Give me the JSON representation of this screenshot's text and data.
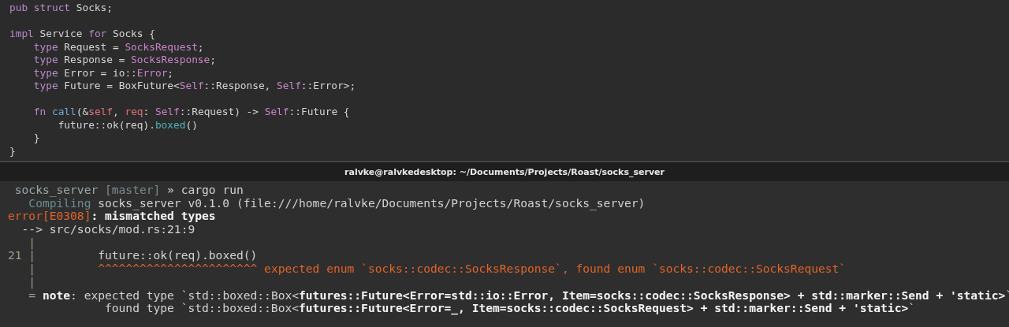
{
  "editor": {
    "lines": [
      {
        "kind": "code",
        "segments": [
          {
            "kind": "keyword",
            "text": "pub struct"
          },
          {
            "kind": "plain",
            "text": " Socks;"
          }
        ]
      },
      {
        "kind": "blank"
      },
      {
        "kind": "code",
        "segments": [
          {
            "kind": "keyword",
            "text": "impl"
          },
          {
            "kind": "plain",
            "text": " Service "
          },
          {
            "kind": "keyword",
            "text": "for"
          },
          {
            "kind": "plain",
            "text": " Socks {"
          }
        ],
        "children": [
          {
            "kind": "code",
            "segments": [
              {
                "kind": "keyword",
                "text": "type"
              },
              {
                "kind": "plain",
                "text": " Request = "
              },
              {
                "kind": "type",
                "text": "SocksRequest"
              },
              {
                "kind": "plain",
                "text": ";"
              }
            ]
          },
          {
            "kind": "code",
            "segments": [
              {
                "kind": "keyword",
                "text": "type"
              },
              {
                "kind": "plain",
                "text": " Response = "
              },
              {
                "kind": "type",
                "text": "SocksResponse"
              },
              {
                "kind": "plain",
                "text": ";"
              }
            ]
          },
          {
            "kind": "code",
            "segments": [
              {
                "kind": "keyword",
                "text": "type"
              },
              {
                "kind": "plain",
                "text": " Error = io::"
              },
              {
                "kind": "type",
                "text": "Error"
              },
              {
                "kind": "plain",
                "text": ";"
              }
            ]
          },
          {
            "kind": "code",
            "segments": [
              {
                "kind": "keyword",
                "text": "type"
              },
              {
                "kind": "plain",
                "text": " Future = BoxFuture<"
              },
              {
                "kind": "type",
                "text": "Self"
              },
              {
                "kind": "plain",
                "text": "::Response, "
              },
              {
                "kind": "type",
                "text": "Self"
              },
              {
                "kind": "plain",
                "text": "::Error>;"
              }
            ]
          },
          {
            "kind": "blank"
          },
          {
            "kind": "code",
            "segments": [
              {
                "kind": "keyword",
                "text": "fn "
              },
              {
                "kind": "function",
                "text": "call"
              },
              {
                "kind": "plain",
                "text": "(&"
              },
              {
                "kind": "variable",
                "text": "self"
              },
              {
                "kind": "plain",
                "text": ", "
              },
              {
                "kind": "variable",
                "text": "req"
              },
              {
                "kind": "plain",
                "text": ": "
              },
              {
                "kind": "type",
                "text": "Self"
              },
              {
                "kind": "plain",
                "text": "::Request) -> "
              },
              {
                "kind": "type",
                "text": "Self"
              },
              {
                "kind": "plain",
                "text": "::Future {"
              }
            ],
            "children": [
              {
                "kind": "code",
                "segments": [
                  {
                    "kind": "plain",
                    "text": "future::ok(req)."
                  },
                  {
                    "kind": "method",
                    "text": "boxed"
                  },
                  {
                    "kind": "plain",
                    "text": "()"
                  }
                ]
              }
            ]
          },
          {
            "kind": "code",
            "segments": [
              {
                "kind": "plain",
                "text": "}"
              }
            ]
          }
        ]
      },
      {
        "kind": "code",
        "segments": [
          {
            "kind": "plain",
            "text": "}"
          }
        ]
      }
    ]
  },
  "terminal": {
    "title": "ralvke@ralvkedesktop: ~/Documents/Projects/Roast/socks_server",
    "lines": [
      {
        "segments": [
          {
            "kind": "prompt",
            "text": " socks_server "
          },
          {
            "kind": "branch",
            "text": "[master]"
          },
          {
            "kind": "plain",
            "text": " » cargo run"
          }
        ]
      },
      {
        "segments": [
          {
            "kind": "dim",
            "text": "   Compiling"
          },
          {
            "kind": "plain",
            "text": " socks_server v0.1.0 (file:///home/ralvke/Documents/Projects/Roast/socks_server)"
          }
        ]
      },
      {
        "segments": [
          {
            "kind": "error",
            "text": "error[E0308]"
          },
          {
            "kind": "bold",
            "text": ": mismatched types"
          }
        ]
      },
      {
        "segments": [
          {
            "kind": "plain",
            "text": "  --> src/socks/mod.rs:21:9"
          }
        ]
      },
      {
        "segments": [
          {
            "kind": "gutter",
            "text": "   |"
          }
        ]
      },
      {
        "segments": [
          {
            "kind": "gutter",
            "text": "21 |"
          },
          {
            "kind": "plain",
            "text": "         future::ok(req).boxed()"
          }
        ]
      },
      {
        "segments": [
          {
            "kind": "gutter",
            "text": "   |"
          },
          {
            "kind": "error",
            "text": "         ^^^^^^^^^^^^^^^^^^^^^^^ expected enum `socks::codec::SocksResponse`, found enum `socks::codec::SocksRequest`"
          }
        ]
      },
      {
        "segments": [
          {
            "kind": "gutter",
            "text": "   |"
          }
        ]
      },
      {
        "segments": [
          {
            "kind": "gutter",
            "text": "   = "
          },
          {
            "kind": "bold",
            "text": "note"
          },
          {
            "kind": "plain",
            "text": ": expected type `std::boxed::Box<"
          },
          {
            "kind": "bold",
            "text": "futures::Future<Error=std::io::Error, Item=socks::codec::SocksResponse> + std::marker::Send + 'static>"
          },
          {
            "kind": "plain",
            "text": "`"
          }
        ]
      },
      {
        "segments": [
          {
            "kind": "plain",
            "text": "              found type `std::boxed::Box<"
          },
          {
            "kind": "bold",
            "text": "futures::Future<Error=_, Item=socks::codec::SocksRequest> + std::marker::Send + 'static>"
          },
          {
            "kind": "plain",
            "text": "`"
          }
        ]
      }
    ]
  }
}
